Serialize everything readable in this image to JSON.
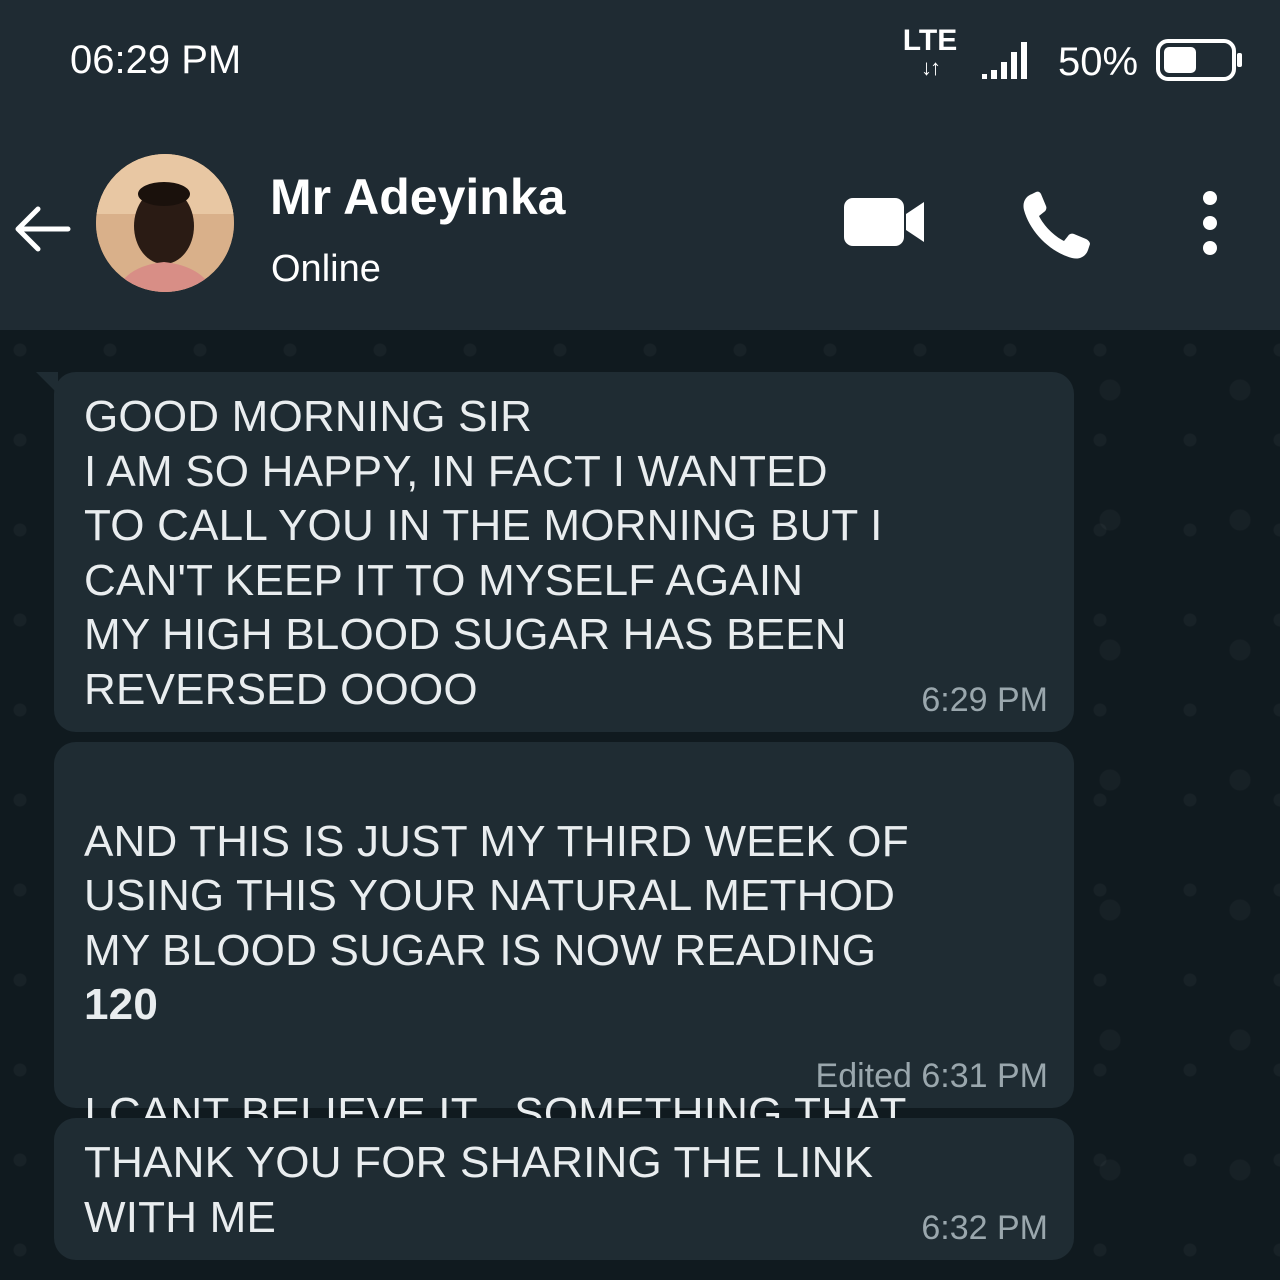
{
  "status_bar": {
    "time": "06:29 PM",
    "network": "LTE",
    "network_arrows": "↓↑",
    "battery_percent": "50%",
    "battery_level": 0.5
  },
  "header": {
    "contact_name": "Mr Adeyinka",
    "contact_status": "Online",
    "icons": [
      "back-arrow-icon",
      "video-call-icon",
      "phone-icon",
      "more-vert-icon"
    ]
  },
  "messages": [
    {
      "text": "GOOD MORNING SIR\nI AM SO HAPPY, IN FACT I WANTED\nTO CALL YOU IN THE MORNING BUT I\nCAN'T KEEP IT TO MYSELF AGAIN\nMY HIGH BLOOD SUGAR HAS BEEN\nREVERSED OOOO",
      "time": "6:29 PM"
    },
    {
      "text_before": "AND THIS IS JUST MY THIRD WEEK OF\nUSING THIS YOUR NATURAL METHOD\nMY BLOOD SUGAR IS NOW READING",
      "number": "120",
      "text_after": "I CANT BELIEVE IT , SOMETHING THAT\nWAS ALWAYS BEEN HIGH",
      "time": "Edited 6:31 PM"
    },
    {
      "text": "THANK YOU FOR SHARING THE LINK\nWITH ME",
      "time": "6:32 PM"
    }
  ],
  "colors": {
    "header_bg": "#1f2b33",
    "chat_bg": "#101a1f",
    "bubble_bg": "#1f2c33",
    "text": "#e9edef",
    "timestamp": "#9aa7ad"
  }
}
